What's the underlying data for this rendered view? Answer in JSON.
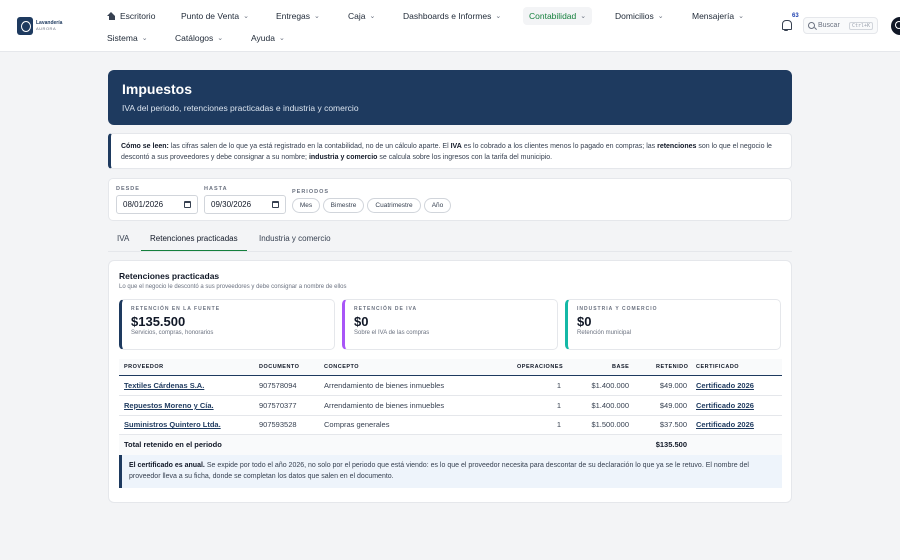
{
  "brand": {
    "name": "Lavandería",
    "sub": "AURORA"
  },
  "nav": {
    "row1": [
      {
        "label": "Escritorio",
        "chev": false,
        "home": true
      },
      {
        "label": "Punto de Venta",
        "chev": true
      },
      {
        "label": "Entregas",
        "chev": true
      },
      {
        "label": "Caja",
        "chev": true
      },
      {
        "label": "Dashboards e Informes",
        "chev": true
      },
      {
        "label": "Contabilidad",
        "chev": true,
        "active": true
      },
      {
        "label": "Domicilios",
        "chev": true
      },
      {
        "label": "Mensajería",
        "chev": true
      }
    ],
    "row2": [
      {
        "label": "Sistema",
        "chev": true
      },
      {
        "label": "Catálogos",
        "chev": true
      },
      {
        "label": "Ayuda",
        "chev": true
      }
    ],
    "notifications": "63",
    "search_label": "Buscar",
    "search_shortcut": "Ctrl+K"
  },
  "hero": {
    "title": "Impuestos",
    "subtitle": "IVA del periodo, retenciones practicadas e industria y comercio"
  },
  "info": {
    "lead": "Cómo se leen:",
    "t1": " las cifras salen de lo que ya está registrado en la contabilidad, no de un cálculo aparte. El ",
    "b1": "IVA",
    "t2": " es lo cobrado a los clientes menos lo pagado en compras; las ",
    "b2": "retenciones",
    "t3": " son lo que el negocio le descontó a sus proveedores y debe consignar a su nombre; ",
    "b3": "industria y comercio",
    "t4": " se calcula sobre los ingresos con la tarifa del municipio."
  },
  "filters": {
    "from_label": "DESDE",
    "from_value": "08/01/2026",
    "to_label": "HASTA",
    "to_value": "09/30/2026",
    "periods_label": "PERIODOS",
    "periods": [
      "Mes",
      "Bimestre",
      "Cuatrimestre",
      "Año"
    ]
  },
  "tabs": [
    "IVA",
    "Retenciones practicadas",
    "Industria y comercio"
  ],
  "section": {
    "title": "Retenciones practicadas",
    "subtitle": "Lo que el negocio le descontó a sus proveedores y debe consignar a nombre de ellos"
  },
  "kpis": [
    {
      "label": "RETENCIÓN EN LA FUENTE",
      "value": "$135.500",
      "note": "Servicios, compras, honorarios"
    },
    {
      "label": "RETENCIÓN DE IVA",
      "value": "$0",
      "note": "Sobre el IVA de las compras"
    },
    {
      "label": "INDUSTRIA Y COMERCIO",
      "value": "$0",
      "note": "Retención municipal"
    }
  ],
  "table": {
    "headers": [
      "PROVEEDOR",
      "DOCUMENTO",
      "CONCEPTO",
      "OPERACIONES",
      "BASE",
      "RETENIDO",
      "CERTIFICADO"
    ],
    "rows": [
      {
        "proveedor": "Textiles Cárdenas S.A.",
        "documento": "907578094",
        "concepto": "Arrendamiento de bienes inmuebles",
        "operaciones": "1",
        "base": "$1.400.000",
        "retenido": "$49.000",
        "certificado": "Certificado 2026"
      },
      {
        "proveedor": "Repuestos Moreno y Cía.",
        "documento": "907570377",
        "concepto": "Arrendamiento de bienes inmuebles",
        "operaciones": "1",
        "base": "$1.400.000",
        "retenido": "$49.000",
        "certificado": "Certificado 2026"
      },
      {
        "proveedor": "Suministros Quintero Ltda.",
        "documento": "907593528",
        "concepto": "Compras generales",
        "operaciones": "1",
        "base": "$1.500.000",
        "retenido": "$37.500",
        "certificado": "Certificado 2026"
      }
    ],
    "total_label": "Total retenido en el periodo",
    "total_value": "$135.500"
  },
  "note": {
    "lead": "El certificado es anual.",
    "text": " Se expide por todo el año 2026, no solo por el periodo que está viendo: es lo que el proveedor necesita para descontar de su declaración lo que ya se le retuvo. El nombre del proveedor lleva a su ficha, donde se completan los datos que salen en el documento."
  }
}
